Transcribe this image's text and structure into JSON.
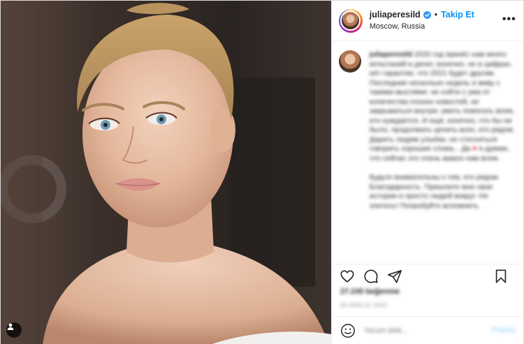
{
  "header": {
    "username": "juliaperesild",
    "follow_label": "Takip Et",
    "separator": "•",
    "location": "Moscow, Russia",
    "more_label": "•••"
  },
  "caption": {
    "username": "juliaperesild",
    "paragraph1": "2020 год принёс нам много испытаний и денег, конечно, не в цифрах, нет гарантии, что 2021 будет другим. Последние несколько недель я живу с такими мыслями: не сойти с ума от количества плохих новостей, не закрываться внутри, уметь помогать всем, кто нуждается. И ещё, конечно, что бы ни было, продолжать ценить всех, кто рядом. Дарить людям улыбки, не стесняться говорить хорошие слова... Да",
    "heart": "♥",
    "paragraph1_end": "я думаю, что сейчас это очень важно нам всем.",
    "paragraph2": "Будьте внимательны к тем, кто рядом. Благодарность. Пришлите мне свои истории и просто людей вокруг. Не злитесь! Попробуйте вспомнить"
  },
  "engagement": {
    "likes": "27.245 beğenme",
    "date": "30 ARALIK 2020"
  },
  "comment_box": {
    "placeholder": "Yorum ekle...",
    "share_label": "Paylaş"
  },
  "icons": {
    "verified": "verified-badge-icon",
    "like": "heart-icon",
    "comment": "comment-icon",
    "share": "paper-plane-icon",
    "save": "bookmark-icon",
    "emoji": "smiley-icon",
    "tag": "person-tag-icon"
  },
  "colors": {
    "accent": "#0095f6",
    "verified": "#3897f0",
    "text": "#262626",
    "muted": "#8e8e8e",
    "share_disabled": "#b2dffc"
  }
}
